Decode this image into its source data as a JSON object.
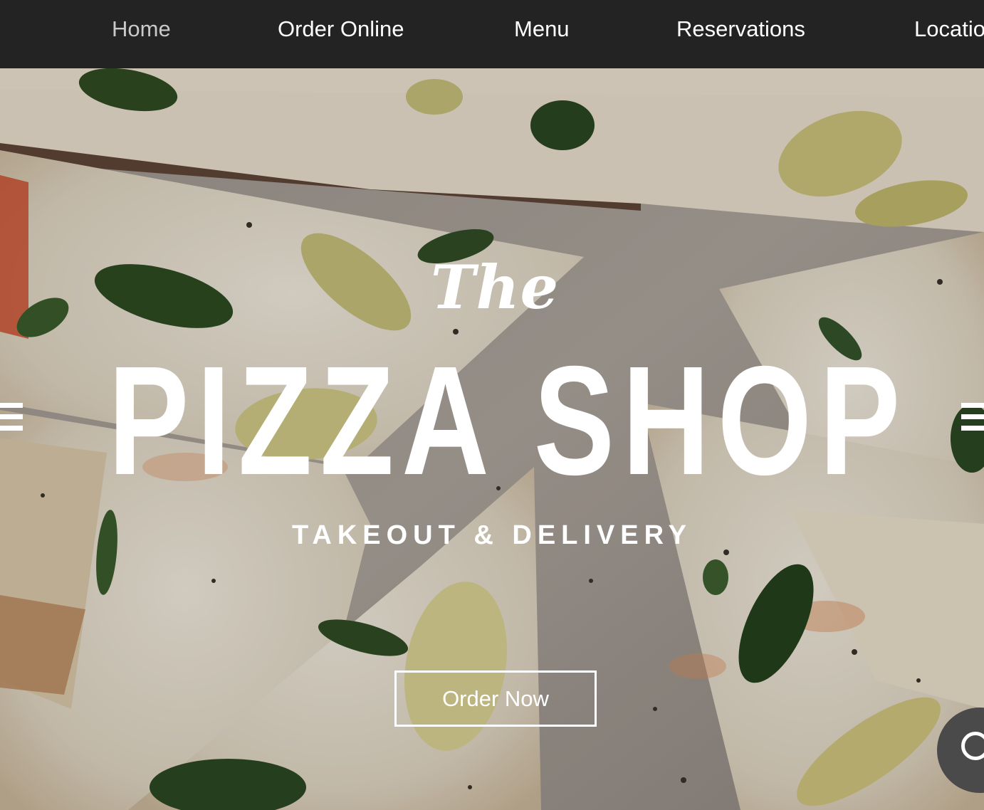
{
  "nav": {
    "items": [
      {
        "label": "Home",
        "active": true
      },
      {
        "label": "Order Online",
        "active": false
      },
      {
        "label": "Menu",
        "active": false
      },
      {
        "label": "Reservations",
        "active": false
      },
      {
        "label": "Locatio",
        "active": false
      }
    ]
  },
  "hero": {
    "title_script": "The",
    "title_main": "PIZZA SHOP",
    "subtitle": "TAKEOUT & DELIVERY",
    "cta_label": "Order Now"
  },
  "colors": {
    "nav_background": "#232323",
    "nav_text": "#ffffff",
    "nav_active_text": "#c9c9c9",
    "hero_text": "#ffffff"
  },
  "icons": {
    "left_decoration": "decorative-lines-icon",
    "right_decoration": "decorative-lines-icon",
    "chat": "chat-icon"
  }
}
